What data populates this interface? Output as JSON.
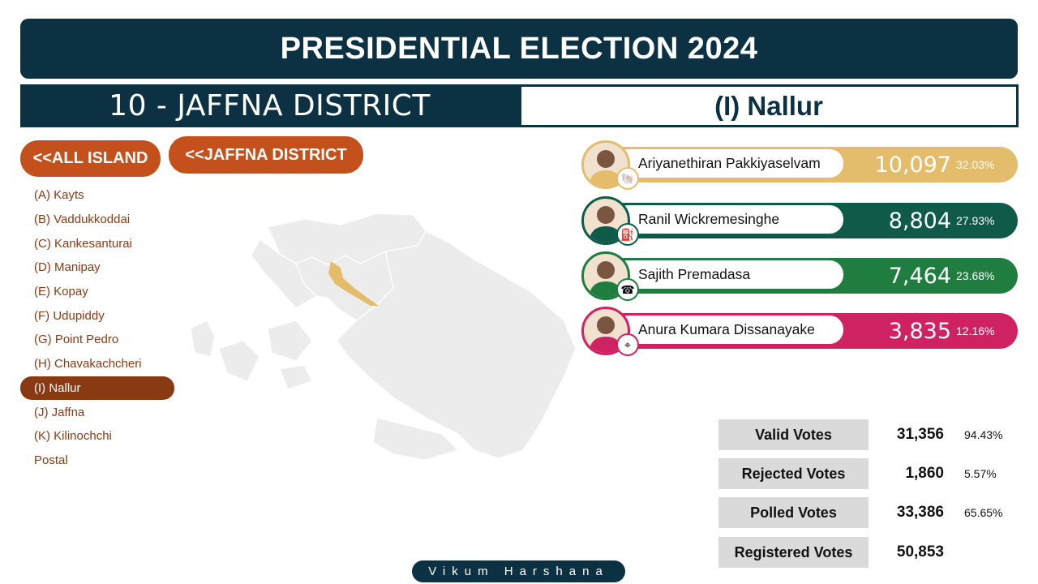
{
  "header": {
    "title": "PRESIDENTIAL ELECTION 2024",
    "district": "10 - JAFFNA DISTRICT",
    "division": "(I) Nallur"
  },
  "nav": {
    "all_island": "<<ALL ISLAND",
    "district": "<<JAFFNA DISTRICT"
  },
  "divisions": [
    {
      "label": "(A) Kayts",
      "active": false
    },
    {
      "label": "(B) Vaddukkoddai",
      "active": false
    },
    {
      "label": "(C) Kankesanturai",
      "active": false
    },
    {
      "label": "(D) Manipay",
      "active": false
    },
    {
      "label": "(E) Kopay",
      "active": false
    },
    {
      "label": "(F) Udupiddy",
      "active": false
    },
    {
      "label": "(G) Point Pedro",
      "active": false
    },
    {
      "label": "(H) Chavakachcheri",
      "active": false
    },
    {
      "label": "(I) Nallur",
      "active": true
    },
    {
      "label": "(J) Jaffna",
      "active": false
    },
    {
      "label": "(K) Kilinochchi",
      "active": false
    },
    {
      "label": "Postal",
      "active": false
    }
  ],
  "candidates": [
    {
      "name": "Ariyanethiran Pakkiyaselvam",
      "votes": "10,097",
      "pct": "32.03%",
      "color": "#e3bd6b",
      "ring": "#e3bd6b",
      "symbol": "conch-icon"
    },
    {
      "name": "Ranil Wickremesinghe",
      "votes": "8,804",
      "pct": "27.93%",
      "color": "#0f5a49",
      "ring": "#0f5a49",
      "symbol": "gas-cylinder-icon"
    },
    {
      "name": "Sajith Premadasa",
      "votes": "7,464",
      "pct": "23.68%",
      "color": "#1f7d3f",
      "ring": "#1f7d3f",
      "symbol": "telephone-icon"
    },
    {
      "name": "Anura Kumara Dissanayake",
      "votes": "3,835",
      "pct": "12.16%",
      "color": "#cf2262",
      "ring": "#cf2262",
      "symbol": "compass-icon"
    }
  ],
  "stats": [
    {
      "label": "Valid Votes",
      "value": "31,356",
      "pct": "94.43%"
    },
    {
      "label": "Rejected Votes",
      "value": "1,860",
      "pct": "5.57%"
    },
    {
      "label": "Polled Votes",
      "value": "33,386",
      "pct": "65.65%"
    },
    {
      "label": "Registered Votes",
      "value": "50,853",
      "pct": ""
    }
  ],
  "credit": "Vikum Harshana",
  "colors": {
    "navy": "#0b3143",
    "nav_button": "#c4501b",
    "list_text": "#8a3a12",
    "map_base": "#ececec",
    "map_highlight": "#e3bd6b"
  }
}
